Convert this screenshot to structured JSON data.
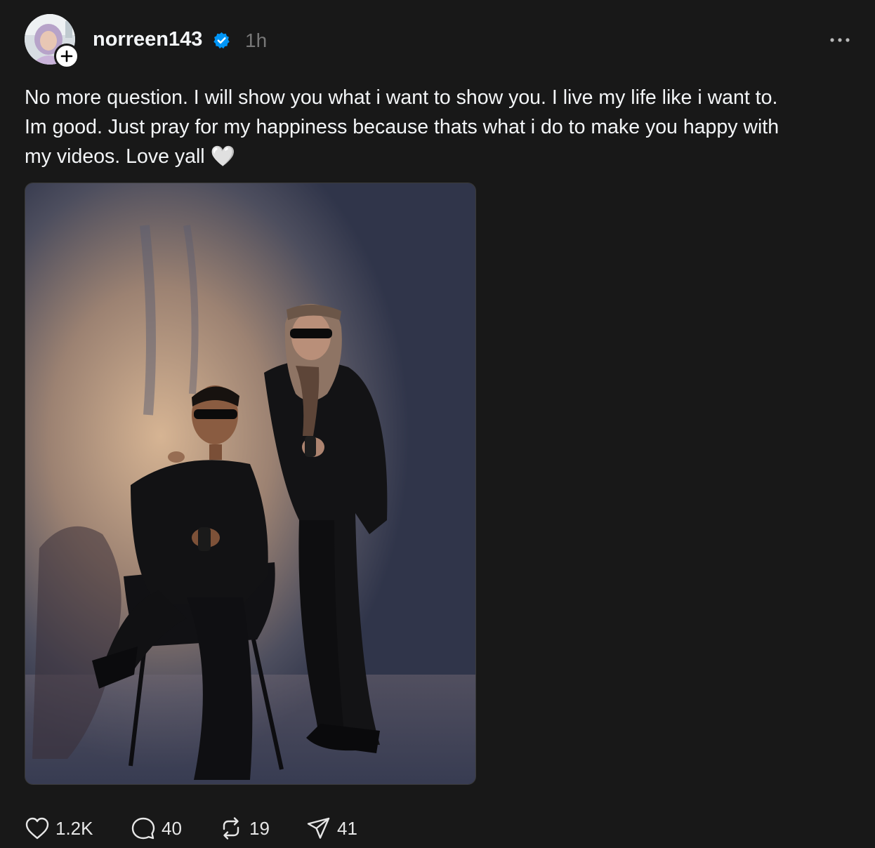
{
  "post": {
    "author": {
      "username": "norreen143",
      "verified": true,
      "timestamp": "1h"
    },
    "caption": "No more question. I will show you what i want to show you. I live my life like i want to.\nIm good. Just pray for my happiness because thats what i do to make you happy with\nmy videos. Love yall 🤍",
    "media": {
      "type": "photo",
      "icon": "photo"
    },
    "actions": {
      "likes": "1.2K",
      "replies": "40",
      "reposts": "19",
      "shares": "41"
    }
  },
  "colors": {
    "background": "#181818",
    "text": "#f3f5f7",
    "muted": "#777777",
    "verified_blue": "#0095f6"
  }
}
